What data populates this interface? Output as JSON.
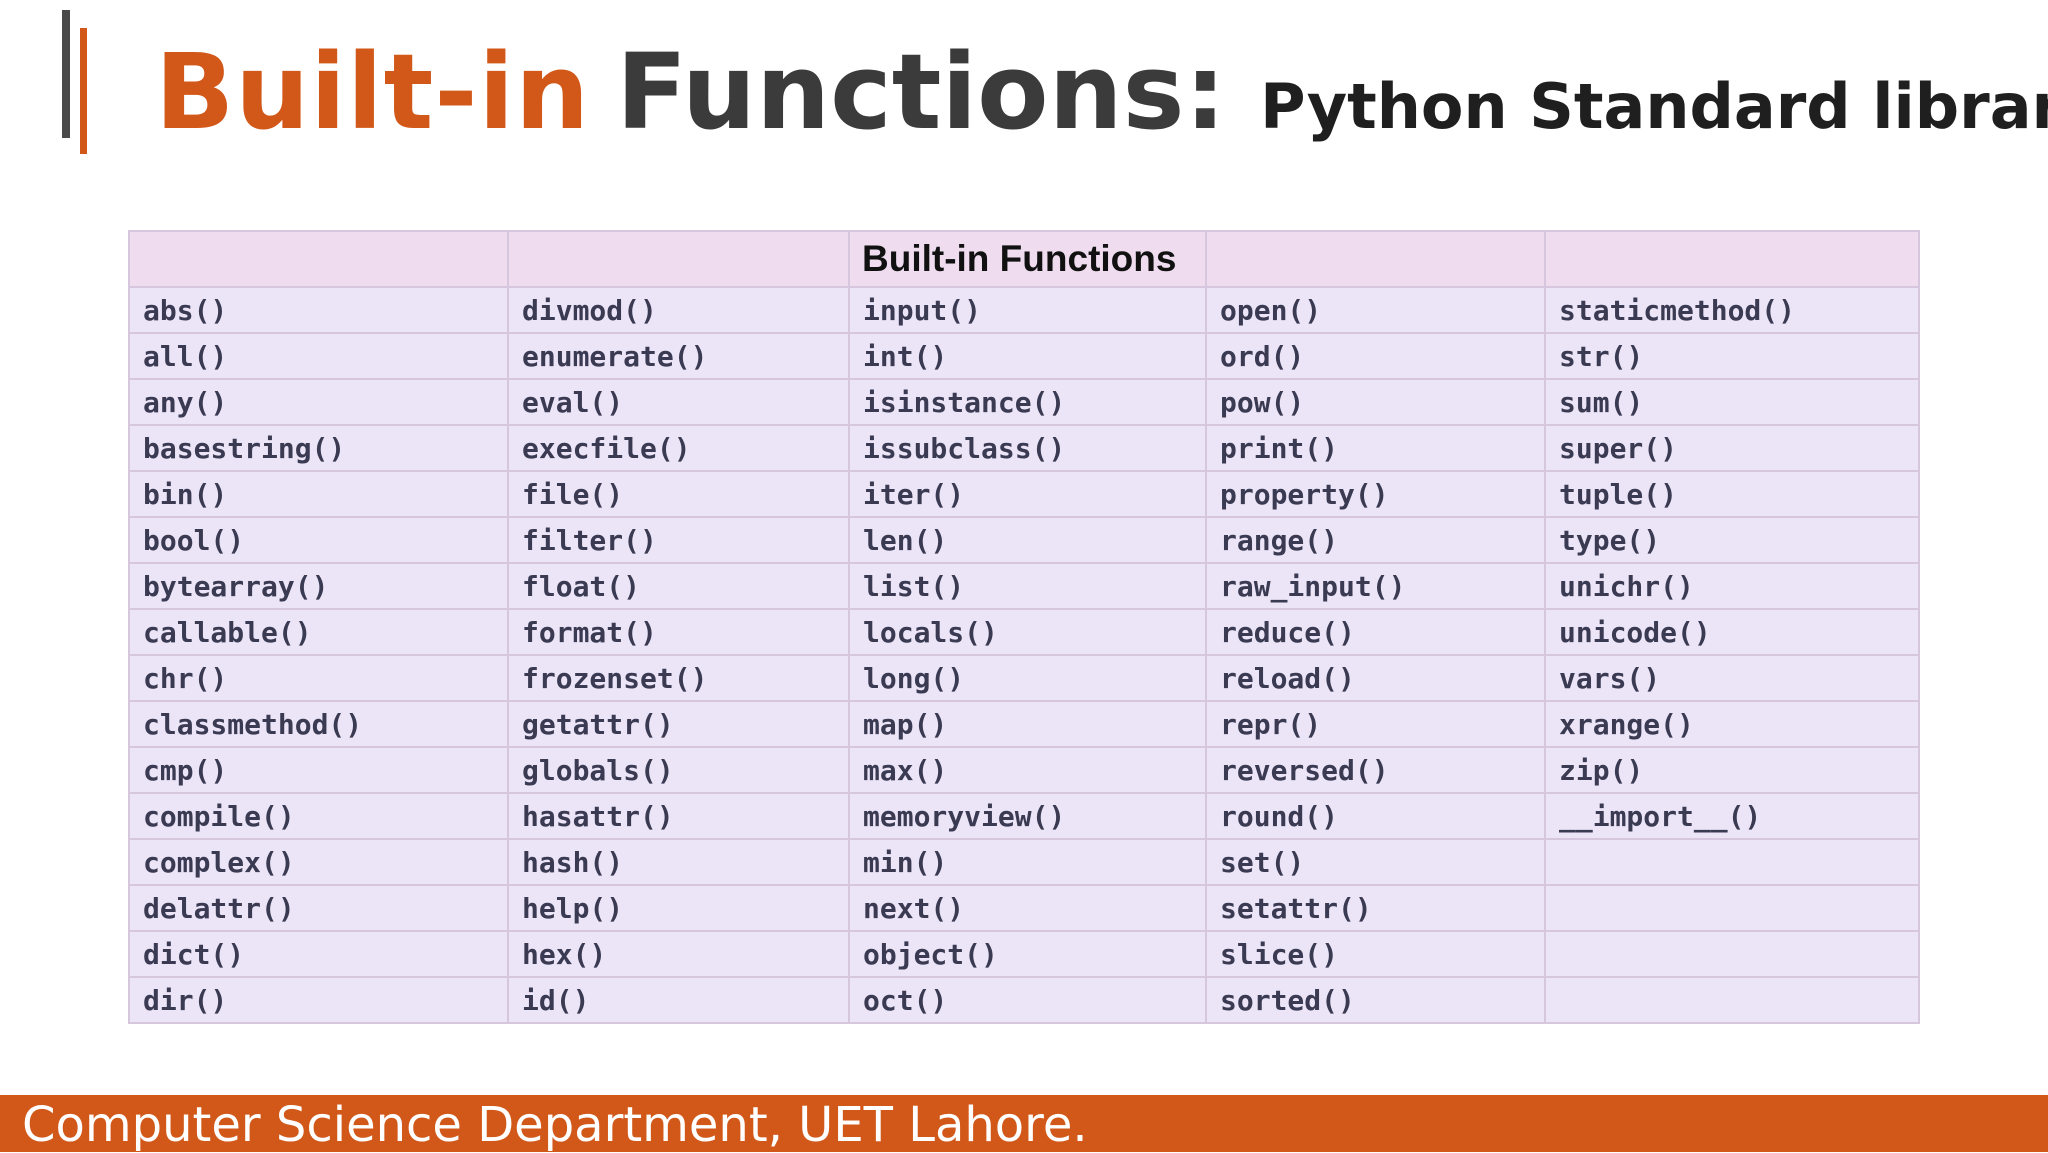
{
  "slide": {
    "title_part1": "Built-in",
    "title_part2": "Functions:",
    "subtitle": "Python Standard library",
    "footer": "Computer Science Department, UET Lahore."
  },
  "table": {
    "header": [
      "",
      "",
      "Built-in Functions",
      "",
      ""
    ],
    "columns": [
      [
        "abs()",
        "all()",
        "any()",
        "basestring()",
        "bin()",
        "bool()",
        "bytearray()",
        "callable()",
        "chr()",
        "classmethod()",
        "cmp()",
        "compile()",
        "complex()",
        "delattr()",
        "dict()",
        "dir()"
      ],
      [
        "divmod()",
        "enumerate()",
        "eval()",
        "execfile()",
        "file()",
        "filter()",
        "float()",
        "format()",
        "frozenset()",
        "getattr()",
        "globals()",
        "hasattr()",
        "hash()",
        "help()",
        "hex()",
        "id()"
      ],
      [
        "input()",
        "int()",
        "isinstance()",
        "issubclass()",
        "iter()",
        "len()",
        "list()",
        "locals()",
        "long()",
        "map()",
        "max()",
        "memoryview()",
        "min()",
        "next()",
        "object()",
        "oct()"
      ],
      [
        "open()",
        "ord()",
        "pow()",
        "print()",
        "property()",
        "range()",
        "raw_input()",
        "reduce()",
        "reload()",
        "repr()",
        "reversed()",
        "round()",
        "set()",
        "setattr()",
        "slice()",
        "sorted()"
      ],
      [
        "staticmethod()",
        "str()",
        "sum()",
        "super()",
        "tuple()",
        "type()",
        "unichr()",
        "unicode()",
        "vars()",
        "xrange()",
        "zip()",
        "__import__()",
        "",
        "",
        "",
        ""
      ]
    ]
  },
  "colors": {
    "accent": "#d2581a",
    "title_dark": "#3b3b3b",
    "header_bg": "#efdcef",
    "cell_bg": "#ece5f8"
  }
}
